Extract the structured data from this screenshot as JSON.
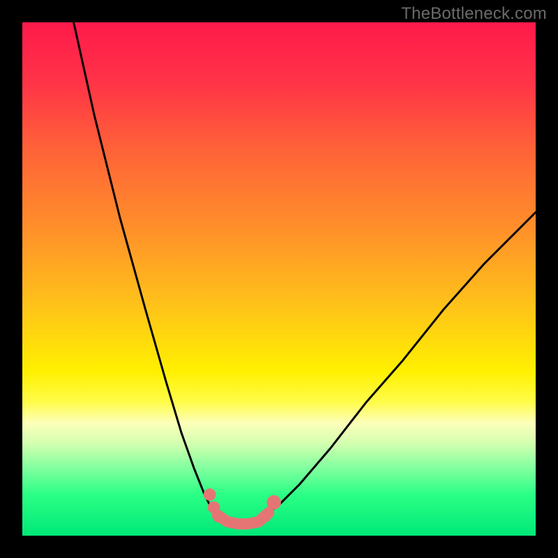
{
  "watermark": {
    "text": "TheBottleneck.com"
  },
  "gradient": {
    "stops": [
      {
        "pct": 0,
        "color": "#ff1a4b"
      },
      {
        "pct": 12,
        "color": "#ff3447"
      },
      {
        "pct": 25,
        "color": "#ff6338"
      },
      {
        "pct": 40,
        "color": "#ff8f2a"
      },
      {
        "pct": 55,
        "color": "#ffc21a"
      },
      {
        "pct": 68,
        "color": "#fff000"
      },
      {
        "pct": 74,
        "color": "#fffc4a"
      },
      {
        "pct": 78,
        "color": "#fdffba"
      },
      {
        "pct": 82,
        "color": "#d4ffb0"
      },
      {
        "pct": 87,
        "color": "#7eff9e"
      },
      {
        "pct": 92,
        "color": "#2bff85"
      },
      {
        "pct": 100,
        "color": "#00e878"
      }
    ]
  },
  "chart_data": {
    "type": "line",
    "title": "",
    "xlabel": "",
    "ylabel": "",
    "xlim": [
      0,
      100
    ],
    "ylim": [
      0,
      100
    ],
    "series": [
      {
        "name": "left-branch",
        "color": "#000000",
        "x": [
          10.0,
          14.0,
          19.0,
          24.0,
          28.0,
          31.0,
          33.5,
          35.5,
          37.0,
          38.0
        ],
        "y": [
          100.0,
          82.0,
          62.0,
          44.0,
          30.0,
          20.0,
          13.0,
          8.0,
          5.0,
          4.0
        ]
      },
      {
        "name": "right-branch",
        "color": "#000000",
        "x": [
          48.0,
          50.0,
          54.0,
          60.0,
          67.0,
          74.0,
          82.0,
          90.0,
          100.0
        ],
        "y": [
          4.5,
          6.0,
          10.0,
          17.0,
          26.0,
          34.0,
          44.0,
          53.0,
          63.0
        ]
      },
      {
        "name": "valley-floor",
        "color": "#e57575",
        "x": [
          38.0,
          40.0,
          42.0,
          44.0,
          46.0,
          48.0
        ],
        "y": [
          4.0,
          2.7,
          2.3,
          2.3,
          2.7,
          4.5
        ]
      }
    ],
    "markers": [
      {
        "x": 36.5,
        "y": 8.0,
        "r": 1.2,
        "color": "#e57575"
      },
      {
        "x": 37.3,
        "y": 5.5,
        "r": 1.2,
        "color": "#e57575"
      },
      {
        "x": 38.2,
        "y": 3.8,
        "r": 1.2,
        "color": "#e57575"
      },
      {
        "x": 47.3,
        "y": 3.8,
        "r": 1.2,
        "color": "#e57575"
      },
      {
        "x": 49.0,
        "y": 6.5,
        "r": 1.4,
        "color": "#e57575"
      }
    ]
  }
}
